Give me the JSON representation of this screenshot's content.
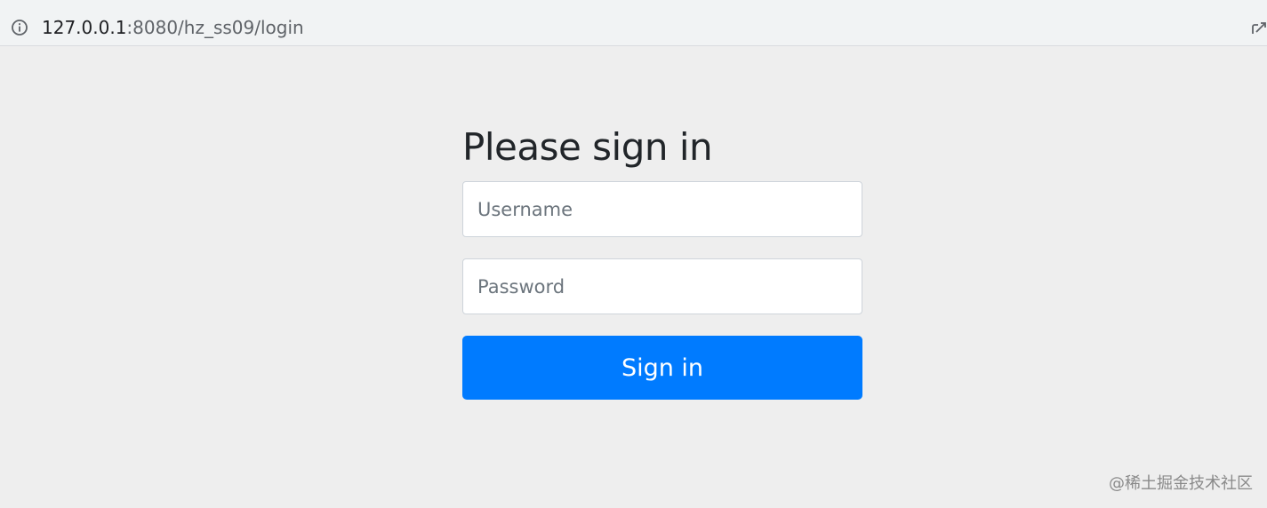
{
  "browser": {
    "url_host": "127.0.0.1",
    "url_rest": ":8080/hz_ss09/login"
  },
  "login": {
    "title": "Please sign in",
    "username_placeholder": "Username",
    "password_placeholder": "Password",
    "submit_label": "Sign in"
  },
  "colors": {
    "page_background": "#eeeeee",
    "button_primary": "#007bff",
    "title_text": "#212529"
  },
  "watermark": "@稀土掘金技术社区"
}
